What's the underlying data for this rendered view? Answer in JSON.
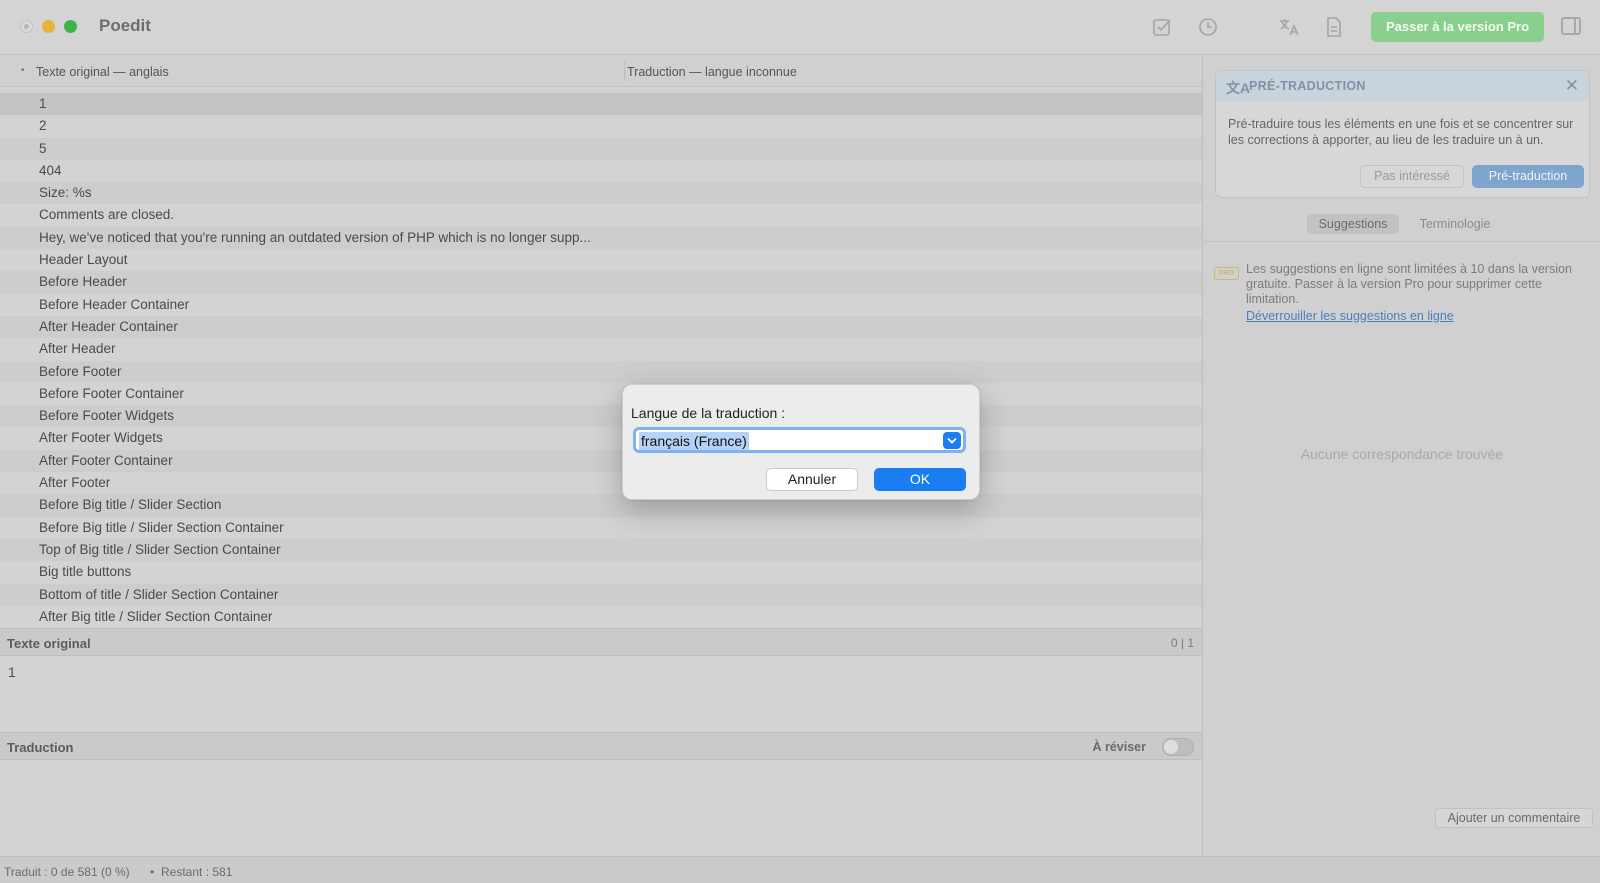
{
  "window": {
    "title": "Poedit",
    "pro_button": "Passer à la version Pro"
  },
  "list": {
    "col_original": "Texte original — anglais",
    "col_translation": "Traduction — langue inconnue",
    "rows": [
      "1",
      "2",
      "5",
      "404",
      "Size: %s",
      "Comments are closed.",
      "Hey, we've noticed that you're running an outdated version of PHP which is no longer supp...",
      "Header Layout",
      "Before Header",
      "Before Header Container",
      "After Header Container",
      "After Header",
      "Before Footer",
      "Before Footer Container",
      "Before Footer Widgets",
      "After Footer Widgets",
      "After Footer Container",
      "After Footer",
      "Before Big title / Slider Section",
      "Before Big title / Slider Section Container",
      "Top of Big title / Slider Section Container",
      "Big title buttons",
      "Bottom of title / Slider Section Container",
      "After Big title / Slider Section Container"
    ]
  },
  "source": {
    "header": "Texte original",
    "counter": "0 | 1",
    "text": "1"
  },
  "translation": {
    "header": "Traduction",
    "review_label": "À réviser"
  },
  "status": {
    "translated": "Traduit : 0 de 581 (0 %)",
    "separator": "•",
    "remaining": "Restant : 581"
  },
  "sidebar": {
    "pretrans_title": "PRÉ-TRADUCTION",
    "pretrans_text": "Pré-traduire tous les éléments en une fois et se concentrer sur les corrections à apporter, au lieu de les traduire un à un.",
    "not_interested": "Pas intéressé",
    "pretranslate": "Pré-traduction",
    "tab_suggestions": "Suggestions",
    "tab_terminology": "Terminologie",
    "pro_badge": "PRO",
    "pro_text": "Les suggestions en ligne sont limitées à 10 dans la version gratuite. Passer à la version Pro pour supprimer cette limitation.",
    "unlock_link": "Déverrouiller les suggestions en ligne",
    "no_match": "Aucune correspondance trouvée",
    "add_comment": "Ajouter un commentaire"
  },
  "dialog": {
    "label": "Langue de la traduction :",
    "value": "français (France)",
    "cancel": "Annuler",
    "ok": "OK"
  }
}
